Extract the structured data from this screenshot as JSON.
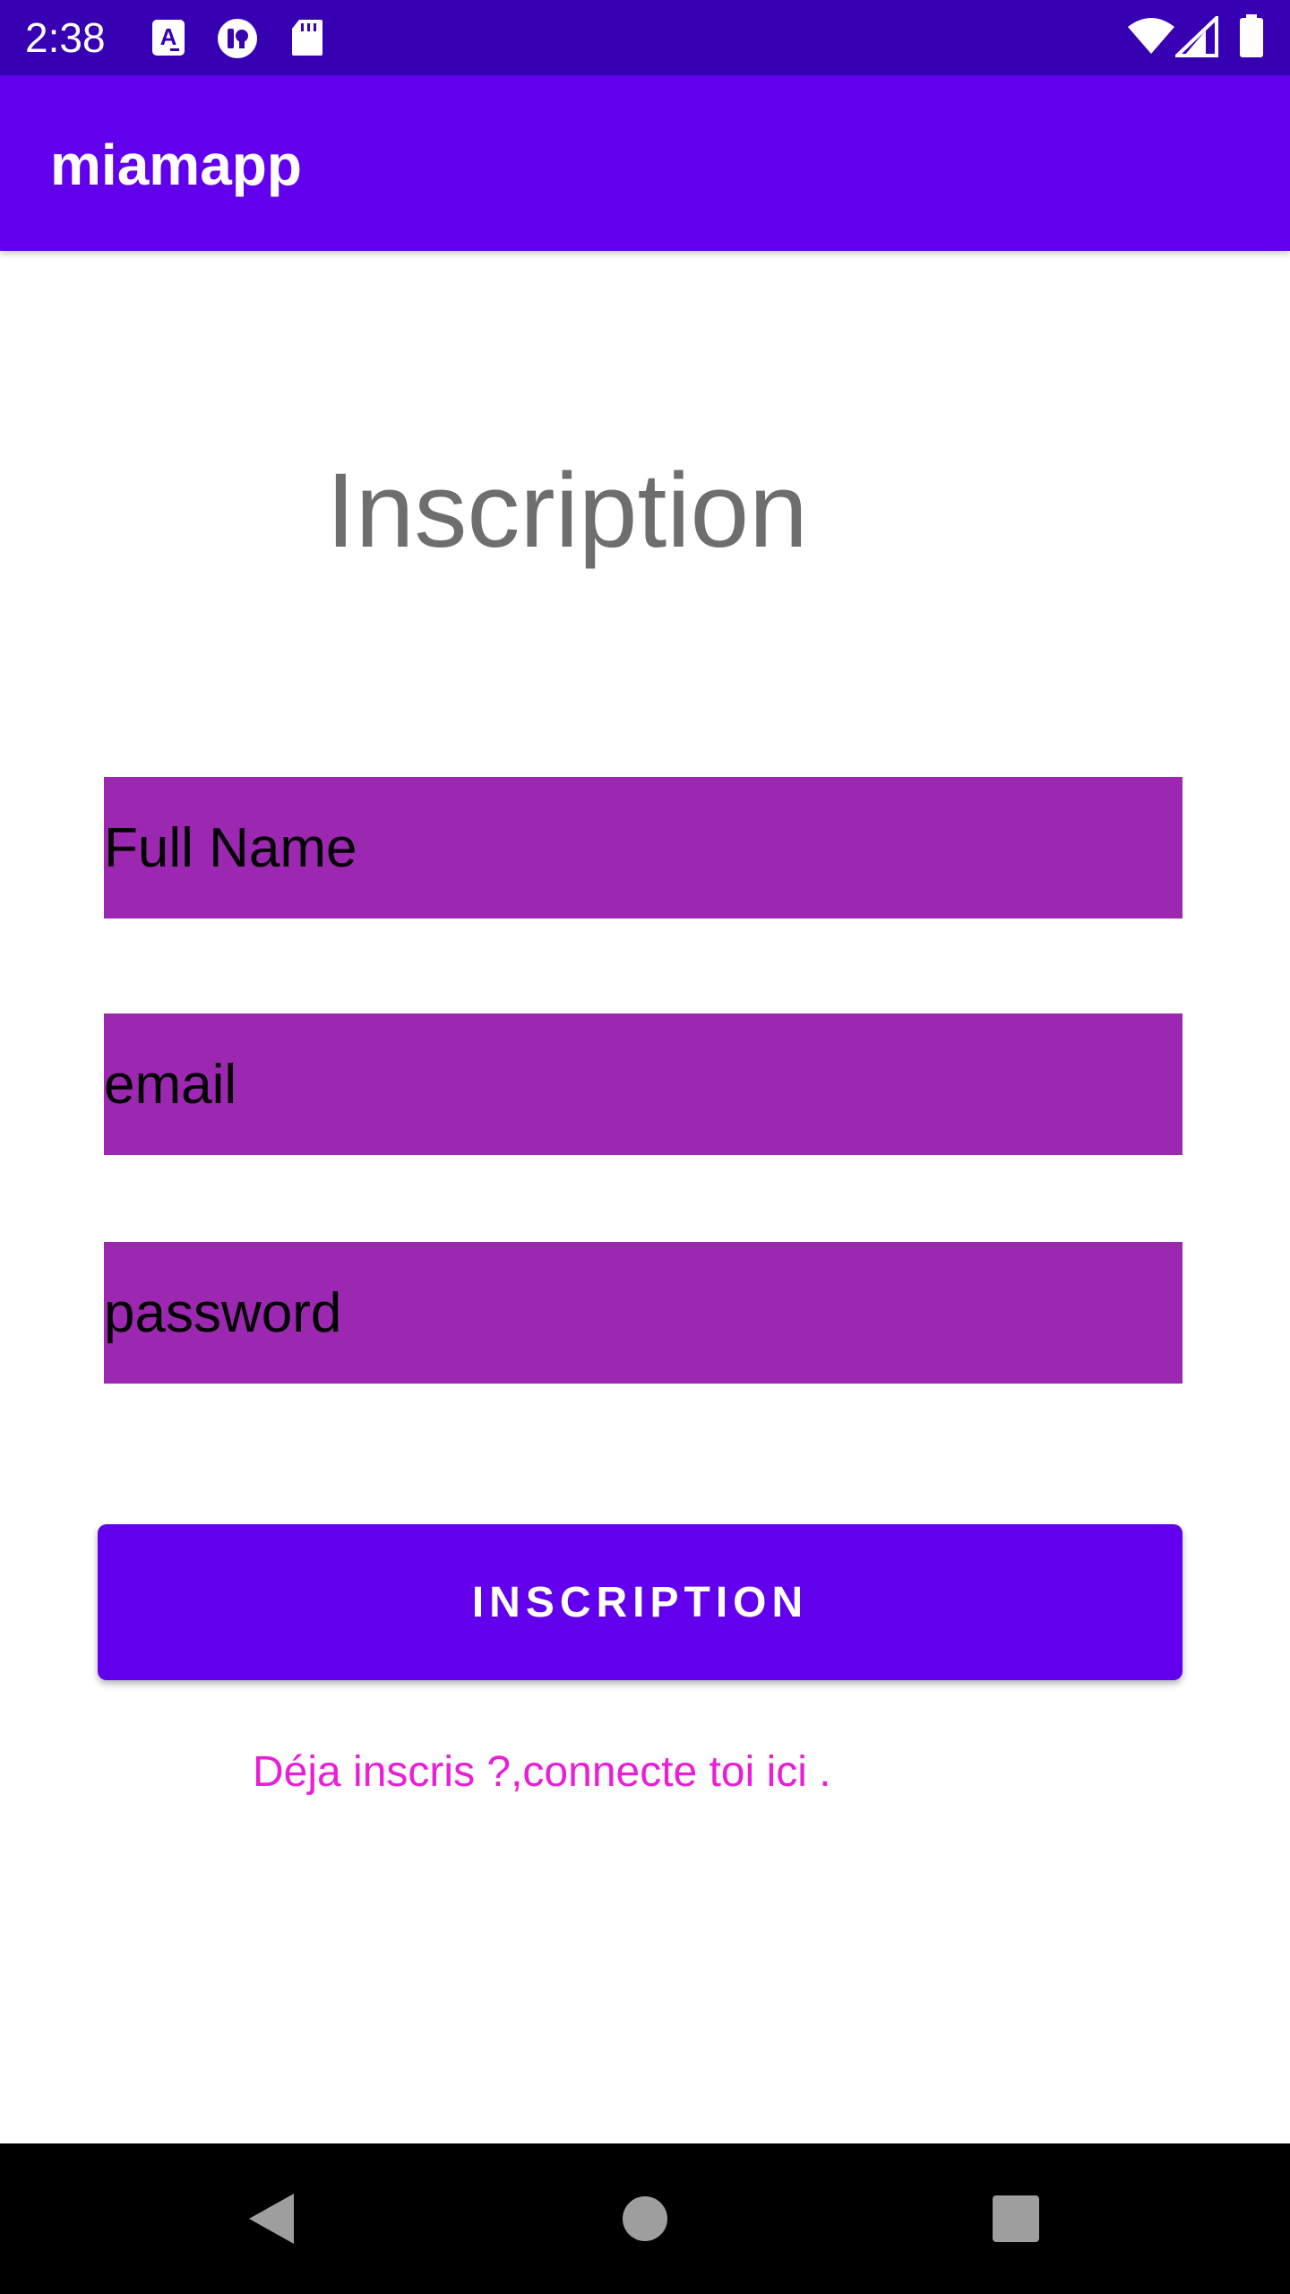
{
  "status_bar": {
    "time": "2:38",
    "left_icons": [
      "font-a-icon",
      "notification-app-icon",
      "sd-card-icon"
    ],
    "right_icons": [
      "wifi-icon",
      "cell-signal-icon",
      "battery-icon"
    ],
    "background": "#3700b3"
  },
  "app_bar": {
    "title": "miamapp",
    "background": "#6200ee"
  },
  "form": {
    "title": "Inscription",
    "fields": [
      {
        "placeholder": "Full Name",
        "value": ""
      },
      {
        "placeholder": "email",
        "value": ""
      },
      {
        "placeholder": "password",
        "value": ""
      }
    ],
    "field_color": "#9c27b0",
    "submit_label": "INSCRIPTION",
    "submit_color": "#6200ee",
    "login_link": "Déja inscris ?,connecte toi ici .",
    "login_link_color": "#e91ed6"
  },
  "nav_bar": {
    "buttons": [
      "back-icon",
      "home-icon",
      "recents-icon"
    ]
  }
}
